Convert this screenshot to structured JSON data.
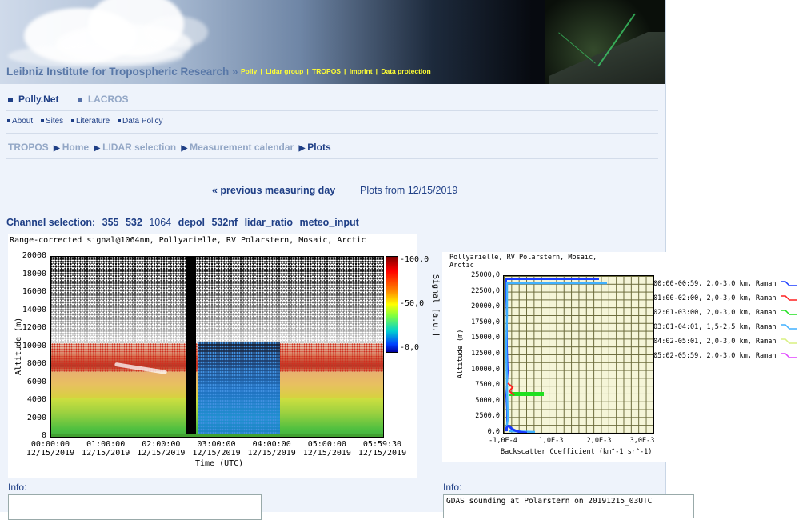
{
  "header": {
    "title": "Leibniz Institute for Tropospheric Research »",
    "nav": [
      "Polly",
      "Lidar group",
      "TROPOS",
      "Imprint",
      "Data protection"
    ],
    "nav_sep": "|"
  },
  "tabs": [
    {
      "label": "Polly.Net",
      "active": true
    },
    {
      "label": "LACROS",
      "active": false
    }
  ],
  "subnav": [
    "About",
    "Sites",
    "Literature",
    "Data Policy"
  ],
  "breadcrumb": [
    "TROPOS",
    "Home",
    "LIDAR selection",
    "Measurement calendar",
    "Plots"
  ],
  "breadcrumb_sep": "▶",
  "date_nav": {
    "prev": "« previous measuring day",
    "current": "Plots from 12/15/2019"
  },
  "channel_selection": {
    "label": "Channel selection:",
    "channels": [
      "355",
      "532",
      "1064",
      "depol",
      "532nf",
      "lidar_ratio",
      "meteo_input"
    ]
  },
  "plot_rcs": {
    "title": "Range-corrected signal@1064nm, Pollyarielle, RV Polarstern, Mosaic, Arctic",
    "y_ticks": [
      "20000",
      "18000",
      "16000",
      "14000",
      "12000",
      "10000",
      "8000",
      "6000",
      "4000",
      "2000",
      "0"
    ],
    "x_ticks": [
      [
        "00:00:00",
        "12/15/2019"
      ],
      [
        "01:00:00",
        "12/15/2019"
      ],
      [
        "02:00:00",
        "12/15/2019"
      ],
      [
        "03:00:00",
        "12/15/2019"
      ],
      [
        "04:00:00",
        "12/15/2019"
      ],
      [
        "05:00:00",
        "12/15/2019"
      ],
      [
        "05:59:30",
        "12/15/2019"
      ]
    ],
    "ylabel": "Altitude (m)",
    "xlabel": "Time (UTC)",
    "colorbar_ticks": [
      "-100,0",
      "-50,0",
      "-0,0"
    ],
    "colorbar_label": "Signal [a.u.]"
  },
  "plot_profile": {
    "title_lines": [
      "Pollyarielle, RV Polarstern, Mosaic,",
      "Arctic"
    ],
    "y_ticks": [
      "25000,0",
      "22500,0",
      "20000,0",
      "17500,0",
      "15000,0",
      "12500,0",
      "10000,0",
      "7500,0",
      "5000,0",
      "2500,0",
      "0,0"
    ],
    "x_ticks": [
      "-1,0E-4",
      "1,0E-3",
      "2,0E-3",
      "3,0E-3"
    ],
    "ylabel": "Altitude (m)",
    "xlabel": "Backscatter Coefficient (km^-1 sr^-1)",
    "legend": [
      {
        "label": "00:00-00:59, 2,0-3,0 km, Raman",
        "color": "#1a3cff"
      },
      {
        "label": "01:00-02:00, 2,0-3,0 km, Raman",
        "color": "#ff2020"
      },
      {
        "label": "02:01-03:00, 2,0-3,0 km, Raman",
        "color": "#20e020"
      },
      {
        "label": "03:01-04:01, 1,5-2,5 km, Raman",
        "color": "#40b0ff"
      },
      {
        "label": "04:02-05:01, 2,0-3,0 km, Raman",
        "color": "#d8f080"
      },
      {
        "label": "05:02-05:59, 2,0-3,0 km, Raman",
        "color": "#e040ff"
      }
    ]
  },
  "info": {
    "label": "Info:",
    "left_text": "",
    "right_text": "GDAS sounding at Polarstern on 20191215_03UTC"
  }
}
